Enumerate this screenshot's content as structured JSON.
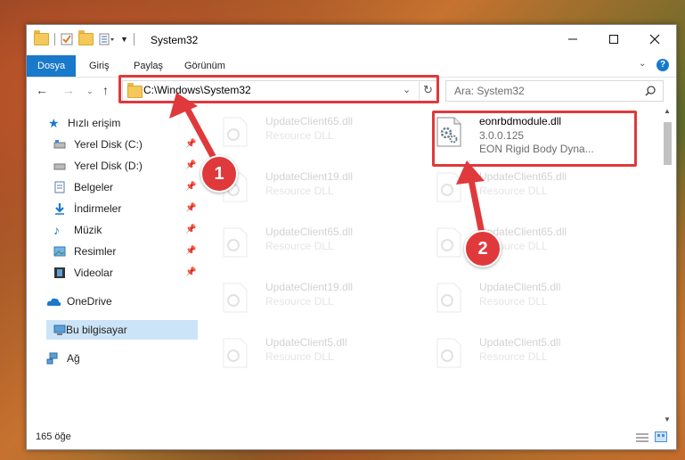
{
  "window": {
    "title": "System32"
  },
  "ribbon": {
    "tabs": [
      "Dosya",
      "Giriş",
      "Paylaş",
      "Görünüm"
    ]
  },
  "address": {
    "path": "C:\\Windows\\System32"
  },
  "search": {
    "placeholder": "Ara: System32"
  },
  "sidebar": {
    "items": [
      {
        "label": "Hızlı erişim"
      },
      {
        "label": "Yerel Disk (C:)"
      },
      {
        "label": "Yerel Disk (D:)"
      },
      {
        "label": "Belgeler"
      },
      {
        "label": "İndirmeler"
      },
      {
        "label": "Müzik"
      },
      {
        "label": "Resimler"
      },
      {
        "label": "Videolar"
      },
      {
        "label": "OneDrive"
      },
      {
        "label": "Bu bilgisayar"
      },
      {
        "label": "Ağ"
      }
    ]
  },
  "files": {
    "highlighted": {
      "name": "eonrbdmodule.dll",
      "version": "3.0.0.125",
      "description": "EON Rigid Body Dyna..."
    },
    "ghost": [
      {
        "name": "UpdateClient65.dll",
        "type": "Resource DLL"
      },
      {
        "name": "UpdateClient19.dll",
        "type": "Resource DLL"
      },
      {
        "name": "UpdateClient65.dll",
        "type": "Resource DLL"
      },
      {
        "name": "UpdateClient65.dll",
        "type": "Resource DLL"
      },
      {
        "name": "UpdateClient65.dll",
        "type": "Resource DLL"
      },
      {
        "name": "UpdateClient19.dll",
        "type": "Resource DLL"
      },
      {
        "name": "UpdateClient5.dll",
        "type": "Resource DLL"
      },
      {
        "name": "UpdateClient5.dll",
        "type": "Resource DLL"
      },
      {
        "name": "UpdateClient5.dll",
        "type": "Resource DLL"
      }
    ]
  },
  "status": {
    "count": "165 öğe"
  },
  "callouts": [
    "1",
    "2"
  ],
  "colors": {
    "accent": "#1979ca",
    "highlight": "#e0393b",
    "selection": "#cce4f7"
  }
}
